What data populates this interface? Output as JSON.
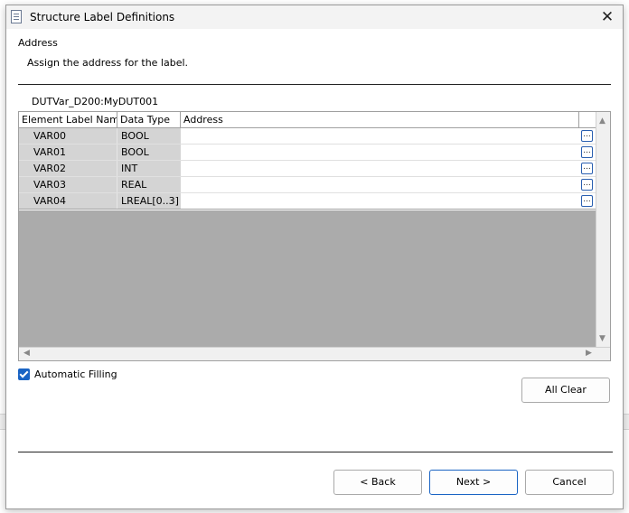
{
  "dialog": {
    "title": "Structure Label Definitions",
    "page_heading": "Address",
    "page_description": "Assign the address for the label.",
    "structure_name": "DUTVar_D200:MyDUT001"
  },
  "grid": {
    "columns": [
      "Element Label Name",
      "Data Type",
      "Address"
    ],
    "rows": [
      {
        "name": "VAR00",
        "type": "BOOL",
        "address": "",
        "button": "..."
      },
      {
        "name": "VAR01",
        "type": "BOOL",
        "address": "",
        "button": "..."
      },
      {
        "name": "VAR02",
        "type": "INT",
        "address": "",
        "button": "..."
      },
      {
        "name": "VAR03",
        "type": "REAL",
        "address": "",
        "button": "..."
      },
      {
        "name": "VAR04",
        "type": "LREAL[0..3]",
        "address": "",
        "button": "..."
      }
    ]
  },
  "options": {
    "automatic_filling_label": "Automatic Filling",
    "automatic_filling_checked": true
  },
  "buttons": {
    "all_clear": "All Clear",
    "back": "< Back",
    "next": "Next >",
    "cancel": "Cancel"
  },
  "colors": {
    "accent": "#1a64c4",
    "readonly_cell": "#d4d4d4",
    "grid_empty": "#ababab"
  }
}
